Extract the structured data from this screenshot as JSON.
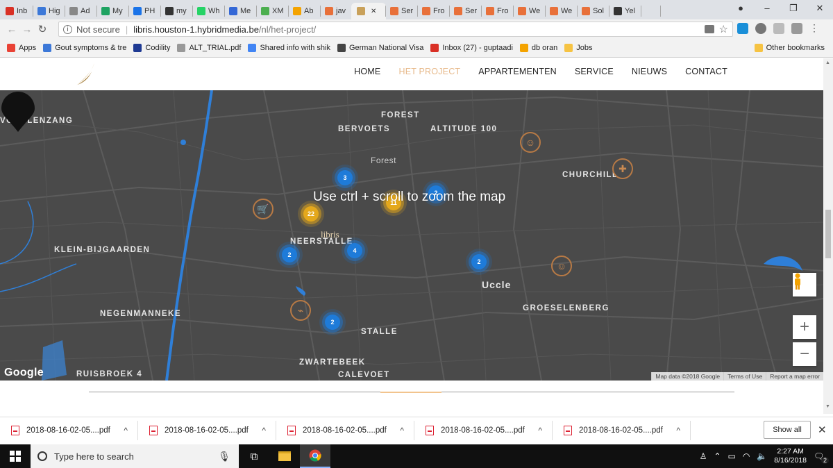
{
  "browser": {
    "tabs": [
      {
        "label": "Inb",
        "color": "#d93025"
      },
      {
        "label": "Hig",
        "color": "#3c78d8"
      },
      {
        "label": "Ad",
        "color": "#888888"
      },
      {
        "label": "My",
        "color": "#1ea362"
      },
      {
        "label": "PH",
        "color": "#1a73e8"
      },
      {
        "label": "my",
        "color": "#333333"
      },
      {
        "label": "Wh",
        "color": "#25d366"
      },
      {
        "label": "Me",
        "color": "#3367d6"
      },
      {
        "label": "XM",
        "color": "#4caf50"
      },
      {
        "label": "Ab",
        "color": "#f4a300"
      },
      {
        "label": "jav",
        "color": "#e8703a"
      },
      {
        "label": "",
        "color": "#c9a15a",
        "active": true
      },
      {
        "label": "Ser",
        "color": "#e8703a"
      },
      {
        "label": "Fro",
        "color": "#e8703a"
      },
      {
        "label": "Ser",
        "color": "#e8703a"
      },
      {
        "label": "Fro",
        "color": "#e8703a"
      },
      {
        "label": "We",
        "color": "#e8703a"
      },
      {
        "label": "We",
        "color": "#e8703a"
      },
      {
        "label": "Sol",
        "color": "#e8703a"
      },
      {
        "label": "Yel",
        "color": "#333333"
      }
    ],
    "address": {
      "security": "Not secure",
      "host": "libris.houston-1.hybridmedia.be",
      "path": "/nl/het-project/"
    },
    "bookmarks": [
      {
        "label": "Apps",
        "color": "#e94235"
      },
      {
        "label": "Gout symptoms & tre",
        "color": "#3c78d8"
      },
      {
        "label": "Codility",
        "color": "#1f3a93"
      },
      {
        "label": "ALT_TRIAL.pdf",
        "color": "#999999"
      },
      {
        "label": "Shared info with shik",
        "color": "#4285f4"
      },
      {
        "label": "German National Visa",
        "color": "#444444"
      },
      {
        "label": "Inbox (27) - guptaadi",
        "color": "#d93025"
      },
      {
        "label": "db oran",
        "color": "#f4a300"
      },
      {
        "label": "Jobs",
        "color": "#f6c343"
      }
    ],
    "other_bookmarks": "Other bookmarks"
  },
  "site": {
    "nav": [
      "HOME",
      "HET PROJECT",
      "APPARTEMENTEN",
      "SERVICE",
      "NIEUWS",
      "CONTACT"
    ],
    "active_nav": "HET PROJECT",
    "accent_color": "#e7b98a"
  },
  "map": {
    "overlay_message": "Use ctrl + scroll to zoom the map",
    "pin_label": "libris",
    "labels": [
      {
        "text": "VOGELENZANG",
        "style": ""
      },
      {
        "text": "BERVOETS",
        "style": ""
      },
      {
        "text": "ALTITUDE 100",
        "style": ""
      },
      {
        "text": "FOREST",
        "style": ""
      },
      {
        "text": "Forest",
        "style": "thin"
      },
      {
        "text": "CHURCHILL",
        "style": ""
      },
      {
        "text": "KLEIN-BIJGAARDEN",
        "style": ""
      },
      {
        "text": "NEERSTALLE",
        "style": ""
      },
      {
        "text": "Uccle",
        "style": "city"
      },
      {
        "text": "GROESELENBERG",
        "style": ""
      },
      {
        "text": "NEGENMANNEKE",
        "style": ""
      },
      {
        "text": "STALLE",
        "style": ""
      },
      {
        "text": "ZWARTEBEEK",
        "style": ""
      },
      {
        "text": "RUISBROEK 4",
        "style": ""
      },
      {
        "text": "CALEVOET",
        "style": ""
      }
    ],
    "clusters": [
      {
        "count": "3",
        "color": "blue"
      },
      {
        "count": "2",
        "color": "blue"
      },
      {
        "count": "22",
        "color": "yellow"
      },
      {
        "count": "11",
        "color": "yellow"
      },
      {
        "count": "2",
        "color": "blue"
      },
      {
        "count": "4",
        "color": "blue"
      },
      {
        "count": "2",
        "color": "blue"
      },
      {
        "count": "2",
        "color": "blue"
      }
    ],
    "google": "Google",
    "attribution": [
      "Map data ©2018 Google",
      "Terms of Use",
      "Report a map error"
    ]
  },
  "downloads": {
    "items": [
      "2018-08-16-02-05....pdf",
      "2018-08-16-02-05....pdf",
      "2018-08-16-02-05....pdf",
      "2018-08-16-02-05....pdf",
      "2018-08-16-02-05....pdf"
    ],
    "show_all": "Show all"
  },
  "taskbar": {
    "search_placeholder": "Type here to search",
    "time": "2:27 AM",
    "date": "8/16/2018",
    "notifications": "2"
  }
}
